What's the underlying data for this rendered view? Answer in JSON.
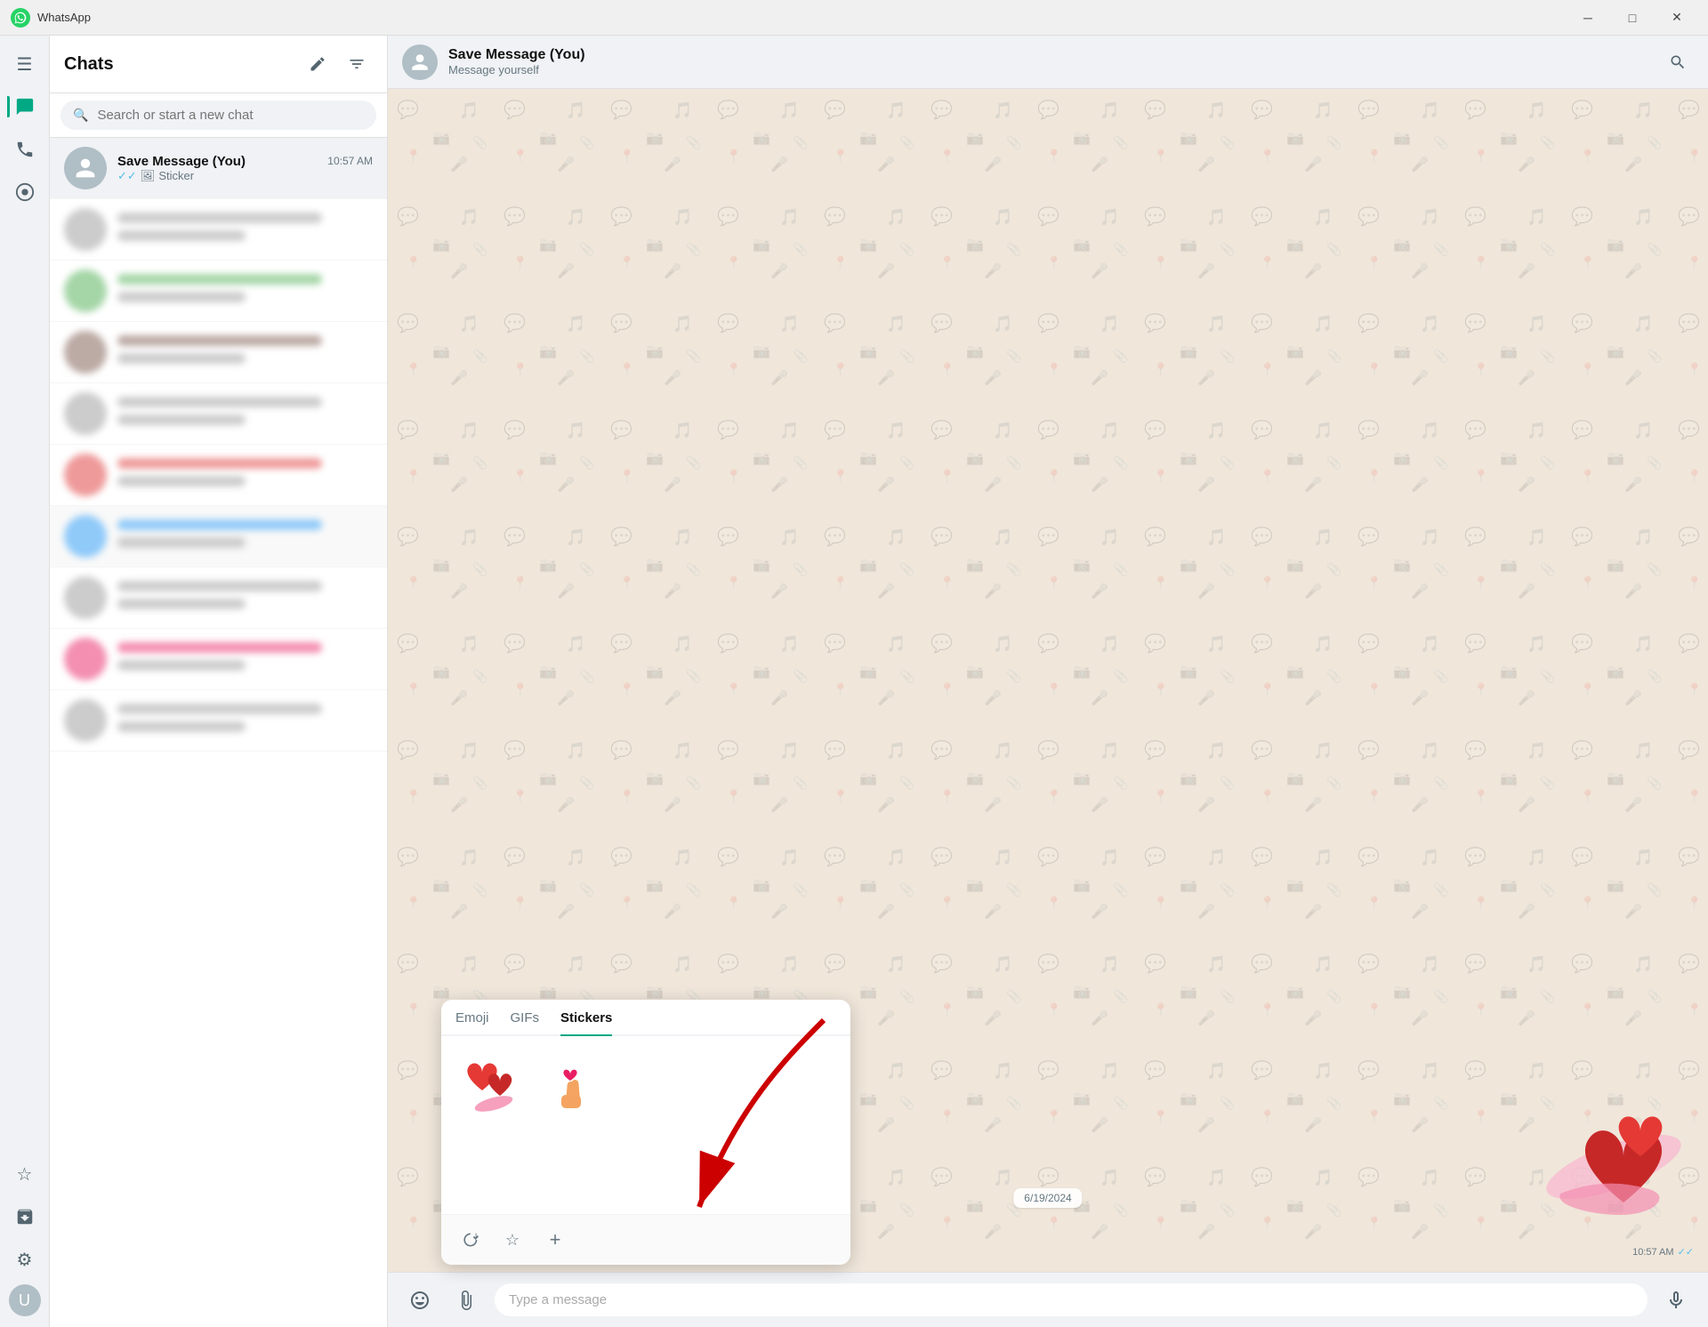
{
  "app": {
    "title": "WhatsApp",
    "logo_unicode": "💬"
  },
  "titlebar": {
    "title": "WhatsApp",
    "minimize": "─",
    "maximize": "□",
    "close": "✕"
  },
  "nav": {
    "items": [
      {
        "id": "menu",
        "icon": "☰",
        "label": "Menu",
        "active": false
      },
      {
        "id": "chats",
        "icon": "💬",
        "label": "Chats",
        "active": true
      },
      {
        "id": "calls",
        "icon": "📞",
        "label": "Calls",
        "active": false
      },
      {
        "id": "status",
        "icon": "⊙",
        "label": "Status",
        "active": false
      }
    ],
    "bottom": [
      {
        "id": "starred",
        "icon": "☆",
        "label": "Starred messages"
      },
      {
        "id": "archived",
        "icon": "🗄",
        "label": "Archived"
      },
      {
        "id": "settings",
        "icon": "⚙",
        "label": "Settings"
      }
    ],
    "avatar_initial": "U"
  },
  "sidebar": {
    "title": "Chats",
    "new_chat_label": "New chat",
    "filter_label": "Filter",
    "search_placeholder": "Search or start a new chat"
  },
  "active_chat": {
    "name": "Save Message (You)",
    "status": "Message yourself",
    "time": "10:57 AM",
    "preview_icon": "✓✓",
    "preview": "Sticker"
  },
  "sticker_picker": {
    "tabs": [
      {
        "id": "emoji",
        "label": "Emoji",
        "active": false
      },
      {
        "id": "gifs",
        "label": "GIFs",
        "active": false
      },
      {
        "id": "stickers",
        "label": "Stickers",
        "active": true
      }
    ],
    "stickers": [
      {
        "id": "hearts",
        "emoji": "❤️‍🔥"
      },
      {
        "id": "heart-hand",
        "emoji": "🫰"
      }
    ],
    "footer_buttons": [
      {
        "id": "recent",
        "icon": "🕐",
        "label": "Recent"
      },
      {
        "id": "starred",
        "icon": "☆",
        "label": "Starred"
      },
      {
        "id": "add",
        "icon": "+",
        "label": "Add"
      }
    ]
  },
  "message_input": {
    "placeholder": "Type a message",
    "emoji_icon": "😊",
    "attach_icon": "📎",
    "mic_icon": "🎤"
  },
  "message": {
    "time": "10:57 AM",
    "check_icon": "✓✓"
  },
  "date_divider": "6/19/2024",
  "chat_header": {
    "search_icon": "🔍"
  }
}
